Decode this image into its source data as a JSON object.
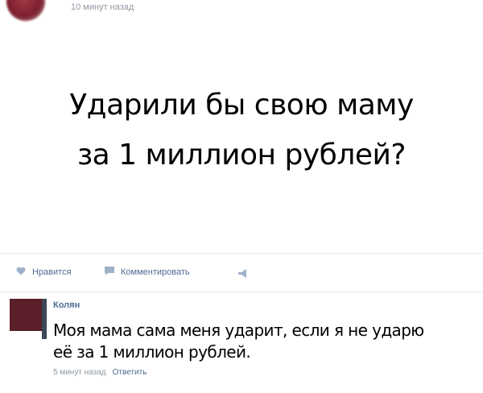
{
  "post": {
    "time": "10 минут назад",
    "text_line1": "Ударили бы свою маму",
    "text_line2": "за 1 миллион рублей?"
  },
  "actions": {
    "like_label": "Нравится",
    "comment_label": "Комментировать"
  },
  "comment": {
    "author": "Колян",
    "text_line1": "Моя мама сама меня ударит, если я не ударю",
    "text_line2": "её за 1 миллион рублей.",
    "time": "5 минут назад",
    "reply_label": "Ответить"
  },
  "colors": {
    "link": "#4f6c93",
    "meta": "#8f98a3",
    "divider": "#e7e8ec"
  },
  "icons": [
    "heart-icon",
    "comment-icon",
    "share-icon"
  ]
}
